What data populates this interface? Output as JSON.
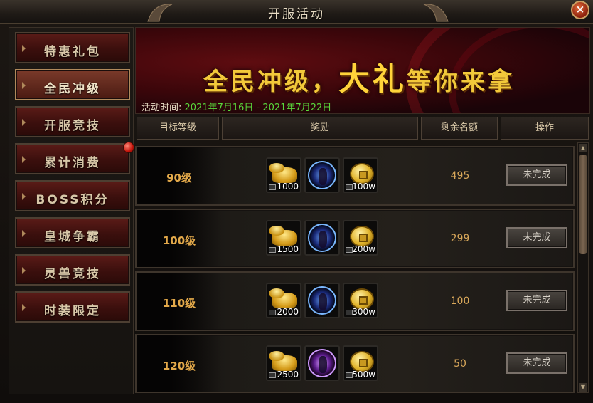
{
  "window": {
    "title": "开服活动",
    "close_label": "×"
  },
  "sidebar": {
    "items": [
      {
        "label": "特惠礼包",
        "active": false,
        "badge": false
      },
      {
        "label": "全民冲级",
        "active": true,
        "badge": false
      },
      {
        "label": "开服竞技",
        "active": false,
        "badge": false
      },
      {
        "label": "累计消费",
        "active": false,
        "badge": true
      },
      {
        "label": "BOSS积分",
        "active": false,
        "badge": false
      },
      {
        "label": "皇城争霸",
        "active": false,
        "badge": false
      },
      {
        "label": "灵兽竞技",
        "active": false,
        "badge": false
      },
      {
        "label": "时装限定",
        "active": false,
        "badge": false
      }
    ]
  },
  "banner": {
    "title_part1": "全民冲级，",
    "title_big": "大礼",
    "title_part2": "等你来拿",
    "time_label": "活动时间:",
    "time_value": "2021年7月16日 - 2021年7月22日"
  },
  "table": {
    "headers": {
      "level": "目标等级",
      "reward": "奖励",
      "remaining": "剩余名额",
      "action": "操作"
    },
    "rows": [
      {
        "level": "90级",
        "gold": "1000",
        "pet": "blue",
        "coin": "100w",
        "remaining": "495",
        "status": "未完成"
      },
      {
        "level": "100级",
        "gold": "1500",
        "pet": "blue",
        "coin": "200w",
        "remaining": "299",
        "status": "未完成"
      },
      {
        "level": "110级",
        "gold": "2000",
        "pet": "blue",
        "coin": "300w",
        "remaining": "100",
        "status": "未完成"
      },
      {
        "level": "120级",
        "gold": "2500",
        "pet": "purple",
        "coin": "500w",
        "remaining": "50",
        "status": "未完成"
      }
    ]
  },
  "colors": {
    "accent_gold": "#f2c93a",
    "time_green": "#5ad83c",
    "level_orange": "#e3a94a"
  },
  "icons": [
    "gold-ingot-icon",
    "spirit-beast-icon",
    "copper-coin-icon",
    "close-icon",
    "red-dot-badge"
  ]
}
